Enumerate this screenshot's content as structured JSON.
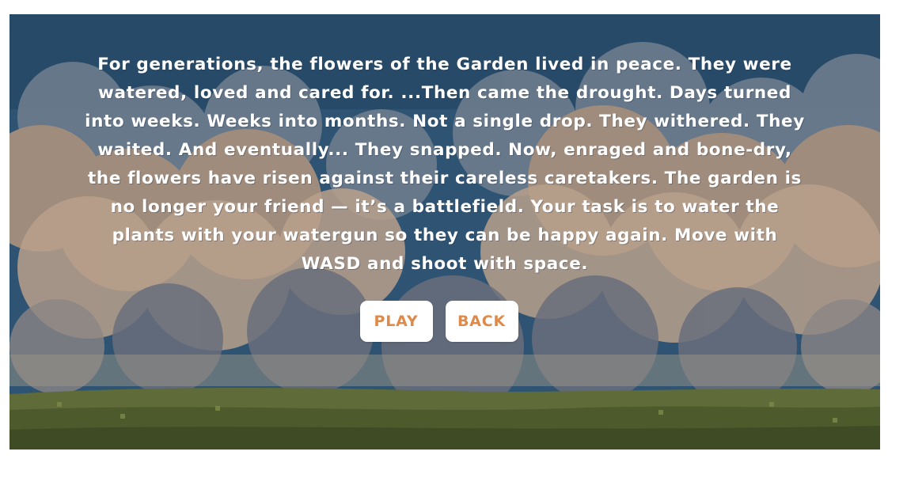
{
  "story": {
    "text": "For generations, the flowers of the Garden lived in peace. They were watered, loved and cared for. ...Then came the drought. Days turned into weeks. Weeks into months. Not a single drop. They withered. They waited. And eventually... They snapped. Now, enraged and bone-dry, the flowers have risen against their careless caretakers. The garden is no longer your friend — it’s a battlefield. Your task is to water the plants with your watergun so they can be happy again. Move with WASD and shoot with space."
  },
  "buttons": {
    "play_label": "PLAY",
    "back_label": "BACK"
  },
  "colors": {
    "button_text": "#e08a4a",
    "button_bg": "#ffffff",
    "story_text": "#ffffff"
  }
}
